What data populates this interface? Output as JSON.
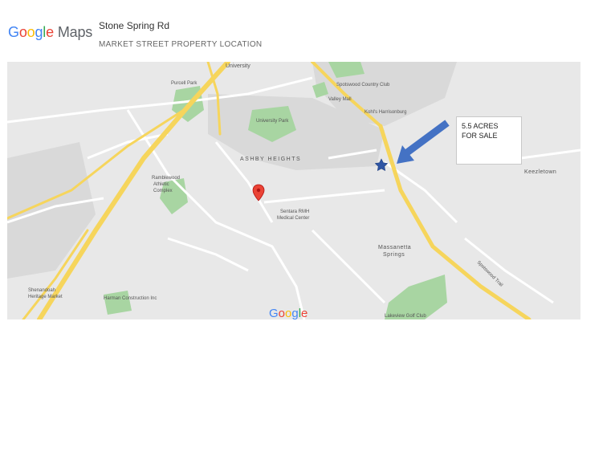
{
  "header": {
    "logo_google": [
      "G",
      "o",
      "o",
      "g",
      "l",
      "e"
    ],
    "logo_maps": "Maps",
    "title": "Stone Spring Rd",
    "subtitle": "MARKET STREET PROPERTY  LOCATION"
  },
  "callout": {
    "line1": "5.5 ACRES",
    "line2": "FOR SALE"
  },
  "map": {
    "watermark": "Google",
    "labels": {
      "university": "University",
      "purcell_park": "Purcell Park",
      "spotswood_cc": "Spotswood Country Club",
      "valley_mall": "Valley Mall",
      "kohls": "Kohl's Harrisonburg",
      "university_park": "University Park",
      "ashby_heights": "ASHBY HEIGHTS",
      "ramblewood": "Ramblewood",
      "athletic_complex": "Athletic",
      "complex": "Complex",
      "sentara1": "Sentara RMH",
      "sentara2": "Medical Center",
      "massanetta1": "Massanetta",
      "massanetta2": "Springs",
      "keezletown": "Keezletown",
      "shenandoah1": "Shenandoah",
      "shenandoah2": "Heritage Market",
      "harman": "Harman Construction Inc",
      "lakeview": "Lakeview Golf Club",
      "spotswood_trail": "Spotswood Trail"
    },
    "colors": {
      "land": "#e8e8e8",
      "highway": "#f6d55c",
      "road": "#ffffff",
      "park": "#a8d5a2",
      "urban": "#d9d9d9",
      "arrow": "#4472c4",
      "star": "#2f55a4",
      "pin": "#ea4335"
    },
    "icons": {
      "marker": "red-location-pin-icon",
      "star": "star-marker-icon",
      "arrow": "blue-arrow-icon"
    }
  }
}
